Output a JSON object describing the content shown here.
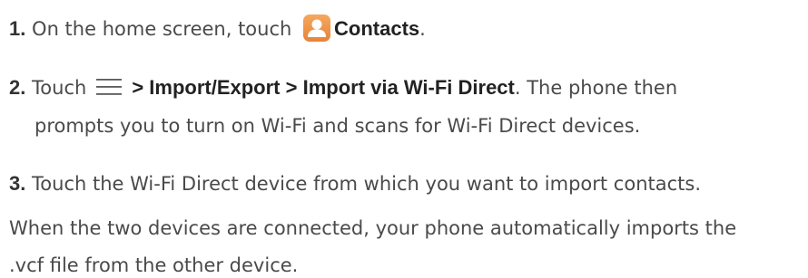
{
  "steps": [
    {
      "num": "1.",
      "pre": "On the home screen, touch",
      "bold": "Contacts",
      "post": ".",
      "icon": "contacts-icon"
    },
    {
      "num": "2.",
      "pre": "Touch",
      "icon": "menu-icon",
      "bold": "> Import/Export > Import via Wi-Fi Direct",
      "post": ". The phone then",
      "line2": "prompts you to turn on Wi-Fi and scans for Wi-Fi Direct devices."
    },
    {
      "num": "3.",
      "text": "Touch the Wi-Fi Direct device from which you want to import contacts."
    }
  ],
  "paragraph": {
    "line1": "When the two devices are connected, your phone automatically imports the",
    "line2": ".vcf file from the other device."
  },
  "colors": {
    "text": "#4a4a4a",
    "icon_orange": "#e7833a"
  }
}
